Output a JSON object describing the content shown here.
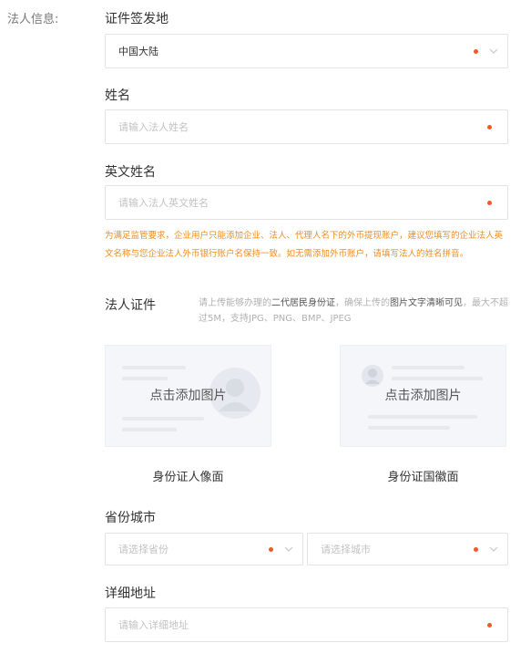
{
  "section_label": "法人信息:",
  "issue_place": {
    "label": "证件签发地",
    "value": "中国大陆"
  },
  "name": {
    "label": "姓名",
    "placeholder": "请输入法人姓名"
  },
  "english_name": {
    "label": "英文姓名",
    "placeholder": "请输入法人英文姓名"
  },
  "notice": {
    "text": "为满足监管要求，企业用户只能添加企业、法人、代理人名下的外币提现账户，建议您填写的企业法人英文名称与您企业法人外币银行账户名保持一致。如无需添加外币账户，请填写法人的姓名拼音。"
  },
  "id_document": {
    "label": "法人证件",
    "hint_part1": "请上传能够办理的",
    "hint_strong1": "二代居民身份证",
    "hint_part2": "，确保上传的",
    "hint_strong2": "图片文字清晰可见",
    "hint_part3": "，最大不超过5M，支持JPG、PNG、BMP、JPEG",
    "upload_front": {
      "text": "点击添加图片",
      "caption": "身份证人像面"
    },
    "upload_back": {
      "text": "点击添加图片",
      "caption": "身份证国徽面"
    }
  },
  "region": {
    "label": "省份城市",
    "province_placeholder": "请选择省份",
    "city_placeholder": "请选择城市"
  },
  "address": {
    "label": "详细地址",
    "placeholder": "请输入详细地址"
  },
  "colors": {
    "required_dot": "#f05a28",
    "notice": "#f08c1e",
    "border": "#e3e3e3"
  }
}
